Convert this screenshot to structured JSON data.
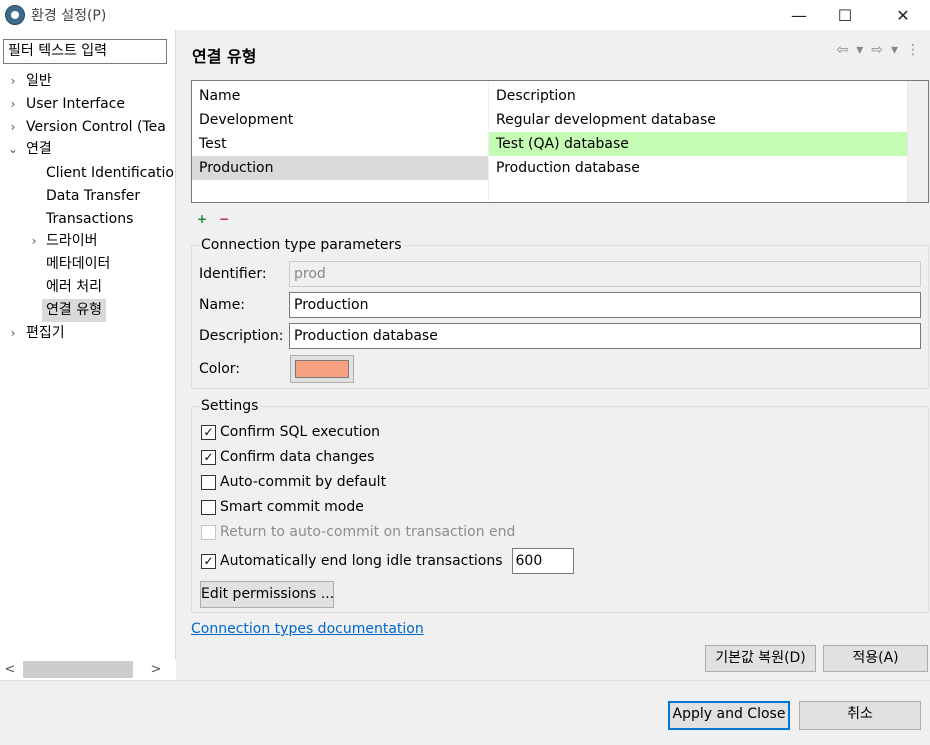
{
  "window": {
    "title": "환경 설정(P)",
    "minimize": "—",
    "maximize": "☐",
    "close": "✕"
  },
  "sidebar": {
    "filter_placeholder": "필터 텍스트 입력",
    "items": [
      {
        "label": "일반",
        "toggle": "›"
      },
      {
        "label": "User Interface",
        "toggle": "›"
      },
      {
        "label": "Version Control (Tea",
        "toggle": "›"
      },
      {
        "label": "연결",
        "toggle": "⌄"
      },
      {
        "label": "Client Identificatio",
        "toggle": ""
      },
      {
        "label": "Data Transfer",
        "toggle": ""
      },
      {
        "label": "Transactions",
        "toggle": ""
      },
      {
        "label": "드라이버",
        "toggle": "›"
      },
      {
        "label": "메타데이터",
        "toggle": ""
      },
      {
        "label": "에러 처리",
        "toggle": ""
      },
      {
        "label": "연결 유형",
        "toggle": ""
      },
      {
        "label": "편집기",
        "toggle": "›"
      }
    ],
    "scroll_left": "<",
    "scroll_right": ">"
  },
  "main": {
    "title": "연결 유형",
    "nav": {
      "back": "⇦",
      "back_menu": "▾",
      "forward": "⇨",
      "forward_menu": "▾",
      "more": "⋮"
    },
    "table": {
      "headers": {
        "name": "Name",
        "description": "Description"
      },
      "rows": [
        {
          "name": "Development",
          "description": "Regular development database"
        },
        {
          "name": "Test",
          "description": "Test (QA) database"
        },
        {
          "name": "Production",
          "description": "Production database"
        }
      ],
      "highlight_color": "#c4fcb4"
    },
    "actions": {
      "add_icon": "+",
      "remove_icon": "−"
    },
    "params": {
      "title": "Connection type parameters",
      "identifier_label": "Identifier:",
      "identifier_value": "prod",
      "name_label": "Name:",
      "name_value": "Production",
      "description_label": "Description:",
      "description_value": "Production database",
      "color_label": "Color:",
      "color_value": "#f5a182"
    },
    "settings": {
      "title": "Settings",
      "checkboxes": [
        {
          "label": "Confirm SQL execution",
          "mark": "✓"
        },
        {
          "label": "Confirm data changes",
          "mark": "✓"
        },
        {
          "label": "Auto-commit by default",
          "mark": ""
        },
        {
          "label": "Smart commit mode",
          "mark": ""
        },
        {
          "label": "Return to auto-commit on transaction end",
          "mark": ""
        },
        {
          "label": "Automatically end long idle transactions",
          "mark": "✓"
        }
      ],
      "idle_timeout": "600",
      "edit_permissions": "Edit permissions ..."
    },
    "doc_link": "Connection types documentation",
    "restore_defaults": "기본값 복원(D)",
    "apply": "적용(A)"
  },
  "footer": {
    "apply_close": "Apply and Close",
    "cancel": "취소"
  }
}
